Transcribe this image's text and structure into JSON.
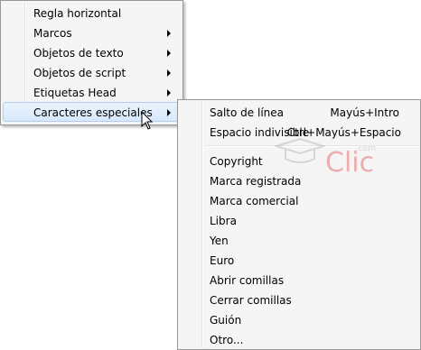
{
  "main_menu": {
    "items": [
      {
        "label": "Regla horizontal"
      },
      {
        "label": "Marcos"
      },
      {
        "label": "Objetos de texto"
      },
      {
        "label": "Objetos de script"
      },
      {
        "label": "Etiquetas Head"
      },
      {
        "label": "Caracteres especiales"
      }
    ]
  },
  "sub_menu": {
    "items": [
      {
        "label": "Salto de línea",
        "shortcut": "Mayús+Intro"
      },
      {
        "label": "Espacio indivisible",
        "shortcut": "Ctrl+Mayús+Espacio"
      },
      {
        "label": "Copyright"
      },
      {
        "label": "Marca registrada"
      },
      {
        "label": "Marca comercial"
      },
      {
        "label": "Libra"
      },
      {
        "label": "Yen"
      },
      {
        "label": "Euro"
      },
      {
        "label": "Abrir comillas"
      },
      {
        "label": "Cerrar comillas"
      },
      {
        "label": "Guión"
      },
      {
        "label": "Otro..."
      }
    ]
  },
  "watermark": {
    "text": "Clic",
    "domain": ".com"
  },
  "colors": {
    "highlight": "#d7e8fb",
    "menu_bg": "#f5f5f5",
    "border": "#979797",
    "watermark": "#e0292f"
  }
}
